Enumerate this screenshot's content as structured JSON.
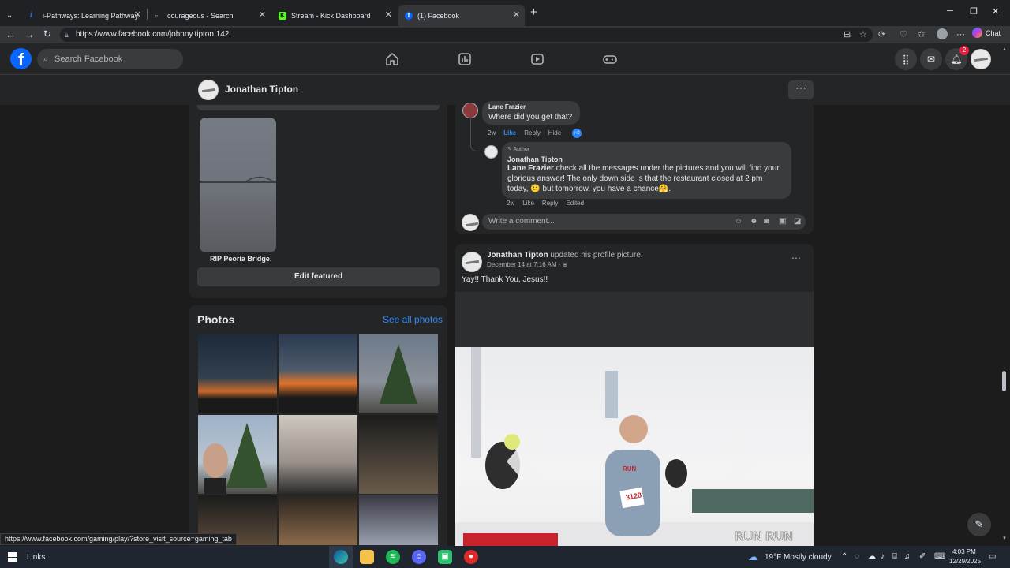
{
  "browser": {
    "tabs": [
      {
        "title": "i-Pathways: Learning Pathways in A",
        "favicon_color": "#1a73e8"
      },
      {
        "title": "courageous - Search",
        "favicon_color": "#5f6368"
      },
      {
        "title": "Stream - Kick Dashboard",
        "favicon_color": "#53fc18"
      },
      {
        "title": "(1) Facebook",
        "favicon_color": "#0866ff"
      }
    ],
    "url": "https://www.facebook.com/johnny.tipton.142",
    "chat_label": "Chat",
    "status_url": "https://www.facebook.com/gaming/play/?store_visit_source=gaming_tab"
  },
  "facebook": {
    "logo": "f",
    "search_placeholder": "Search Facebook",
    "nav_icons": [
      "home-icon",
      "marketplace-icon",
      "watch-icon",
      "gaming-icon"
    ],
    "right_icons": [
      "menu-grid-icon",
      "messenger-icon",
      "notifications-icon"
    ],
    "notification_count": "2",
    "accent": "#0866ff"
  },
  "profile": {
    "name": "Jonathan Tipton",
    "featured_caption": "RIP Peoria Bridge.",
    "edit_featured": "Edit featured",
    "photos_title": "Photos",
    "see_all_photos": "See all photos"
  },
  "comments": {
    "first": {
      "author": "Lane Frazier",
      "text": "Where did you get that?",
      "time": "2w",
      "like": "Like",
      "reply": "Reply",
      "hide": "Hide"
    },
    "reply": {
      "badge": "Author",
      "author": "Jonathan Tipton",
      "mention": "Lane Frazier",
      "text_line1": " check all the messages under the pictures and you will find your",
      "text_line2": "glorious answer! The only down side is that the restaurant closed at 2 pm",
      "text_line3": "today, 😕 but tomorrow, you have a chance🤗.",
      "time": "2w",
      "like": "Like",
      "reply": "Reply",
      "edited": "Edited"
    },
    "write_placeholder": "Write a comment..."
  },
  "post": {
    "author": "Jonathan Tipton",
    "action": " updated his profile picture.",
    "date": "December 14 at 7:16 AM · ",
    "text": "Yay!! Thank You, Jesus!!",
    "bib_number": "3128",
    "shirt_text": "RUN",
    "banner_text": "RUN RUN"
  },
  "taskbar": {
    "links_label": "Links",
    "weather_temp": "19°F",
    "weather_desc": "Mostly cloudy",
    "time": "4:03 PM",
    "date": "12/29/2025"
  }
}
